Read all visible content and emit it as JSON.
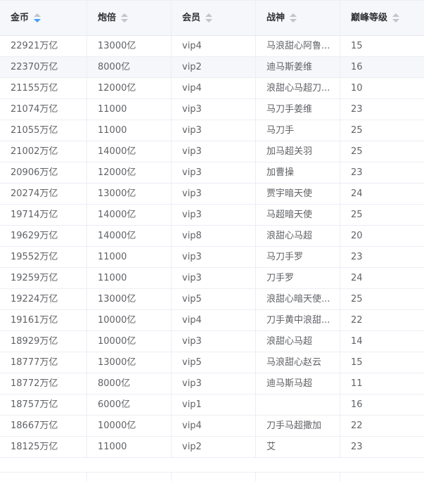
{
  "table": {
    "columns": [
      "金币",
      "炮倍",
      "会员",
      "战神",
      "巅峰等级"
    ],
    "rows": [
      [
        "22921万亿",
        "13000亿",
        "vip4",
        "马浪甜心阿鲁...",
        "15"
      ],
      [
        "22370万亿",
        "8000亿",
        "vip2",
        "迪马斯姜维",
        "16"
      ],
      [
        "21155万亿",
        "12000亿",
        "vip4",
        "浪甜心马超刀...",
        "10"
      ],
      [
        "21074万亿",
        "11000",
        "vip3",
        "马刀手姜维",
        "23"
      ],
      [
        "21055万亿",
        "11000",
        "vip3",
        "马刀手",
        "25"
      ],
      [
        "21002万亿",
        "14000亿",
        "vip3",
        "加马超关羽",
        "25"
      ],
      [
        "20906万亿",
        "12000亿",
        "vip3",
        "加曹操",
        "23"
      ],
      [
        "20274万亿",
        "13000亿",
        "vip3",
        "贾宇暗天使",
        "24"
      ],
      [
        "19714万亿",
        "14000亿",
        "vip3",
        "马超暗天使",
        "25"
      ],
      [
        "19629万亿",
        "14000亿",
        "vip8",
        "浪甜心马超",
        "20"
      ],
      [
        "19552万亿",
        "11000",
        "vip3",
        "马刀手罗",
        "23"
      ],
      [
        "19259万亿",
        "11000",
        "vip3",
        "刀手罗",
        "24"
      ],
      [
        "19224万亿",
        "13000亿",
        "vip5",
        "浪甜心暗天使...",
        "25"
      ],
      [
        "19161万亿",
        "10000亿",
        "vip4",
        "刀手黄中浪甜...",
        "22"
      ],
      [
        "18929万亿",
        "10000亿",
        "vip3",
        "浪甜心马超",
        "14"
      ],
      [
        "18777万亿",
        "13000亿",
        "vip5",
        "马浪甜心赵云",
        "15"
      ],
      [
        "18772万亿",
        "8000亿",
        "vip3",
        "迪马斯马超",
        "11"
      ],
      [
        "18757万亿",
        "6000亿",
        "vip1",
        "",
        "16"
      ],
      [
        "18667万亿",
        "10000亿",
        "vip4",
        "刀手马超撒加",
        "22"
      ],
      [
        "18125万亿",
        "11000",
        "vip2",
        "艾",
        "23"
      ]
    ],
    "hover_row_index": 1,
    "sort_active_column": 0,
    "sort_active_direction": "descending"
  },
  "colors": {
    "header_bg": "#f5f7fa",
    "border": "#ebeef5",
    "sort_active": "#409eff",
    "sort_inactive": "#c0c4cc",
    "text": "#606266",
    "header_text": "#303133"
  }
}
